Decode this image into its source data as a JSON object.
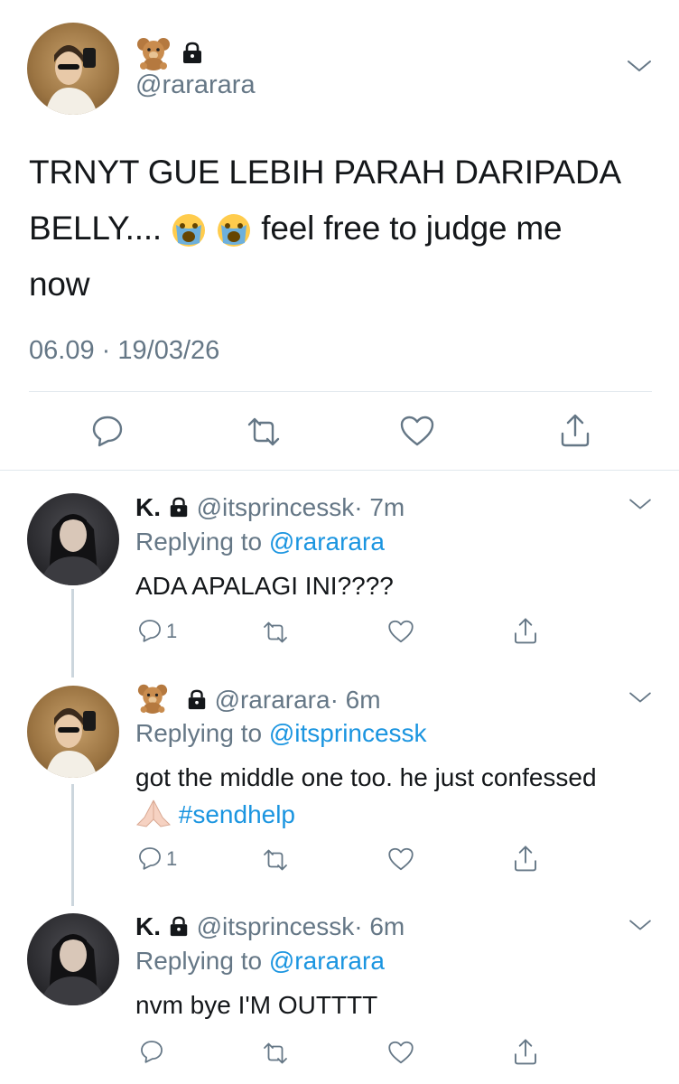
{
  "main_tweet": {
    "handle": "@rarararа",
    "text_line1": "TRNYT GUE LEBIH PARAH DARIPADA",
    "text_line2a": "BELLY....",
    "text_line2b": "feel free to judge me",
    "text_line3": "now",
    "time": "06.09",
    "separator": "·",
    "date": "19/03/26",
    "name_emoji": "teddy-bear-emoji"
  },
  "replies": [
    {
      "name": "K.",
      "handle": "@itsprincessk",
      "time": "· 7m",
      "replying_prefix": "Replying to",
      "replying_to": "@rarararа",
      "text": "ADA APALAGI INI????",
      "reply_count": "1"
    },
    {
      "handle": "@rarararа",
      "time": "· 6m",
      "replying_prefix": "Replying to",
      "replying_to": "@itsprincessk",
      "text_line1": "got the middle one too. he just confessed",
      "hashtag": "#sendhelp",
      "reply_count": "1"
    },
    {
      "name": "K.",
      "handle": "@itsprincessk",
      "time": "· 6m",
      "replying_prefix": "Replying to",
      "replying_to": "@rarararа",
      "text": "nvm bye I'M OUTTTT"
    }
  ],
  "colors": {
    "accent": "#1b95e0",
    "muted": "#657786",
    "divider": "#e1e8ed"
  }
}
